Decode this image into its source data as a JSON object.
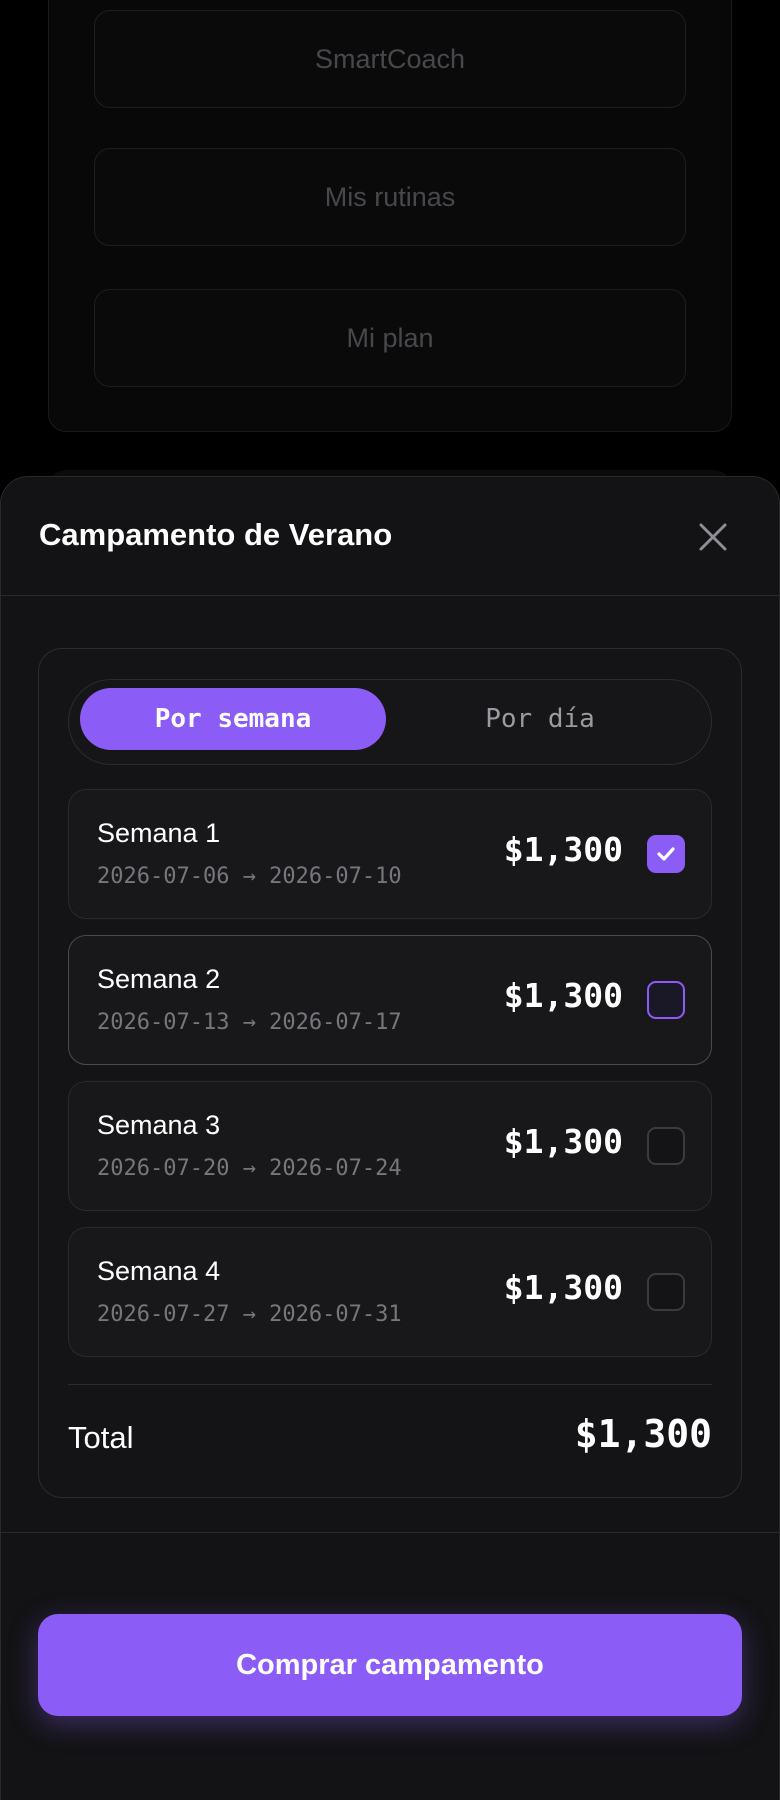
{
  "background": {
    "buttons": [
      "SmartCoach",
      "Mis rutinas",
      "Mi plan"
    ]
  },
  "sheet": {
    "title": "Campamento de Verano",
    "close_icon": "close-icon"
  },
  "toggle": {
    "options": [
      "Por semana",
      "Por día"
    ],
    "selected": "Por semana"
  },
  "weeks": [
    {
      "name": "Semana 1",
      "dates": "2026-07-06 → 2026-07-10",
      "price": "$1,300",
      "checked": true
    },
    {
      "name": "Semana 2",
      "dates": "2026-07-13 → 2026-07-17",
      "price": "$1,300",
      "checked": false
    },
    {
      "name": "Semana 3",
      "dates": "2026-07-20 → 2026-07-24",
      "price": "$1,300",
      "checked": false
    },
    {
      "name": "Semana 4",
      "dates": "2026-07-27 → 2026-07-31",
      "price": "$1,300",
      "checked": false
    }
  ],
  "summary": {
    "total_label": "Total",
    "total_value": "$1,300"
  },
  "cta": {
    "label": "Comprar campamento"
  },
  "colors": {
    "accent": "#8b5cf6",
    "sheet_bg": "#131315",
    "text_muted": "#76767c"
  }
}
